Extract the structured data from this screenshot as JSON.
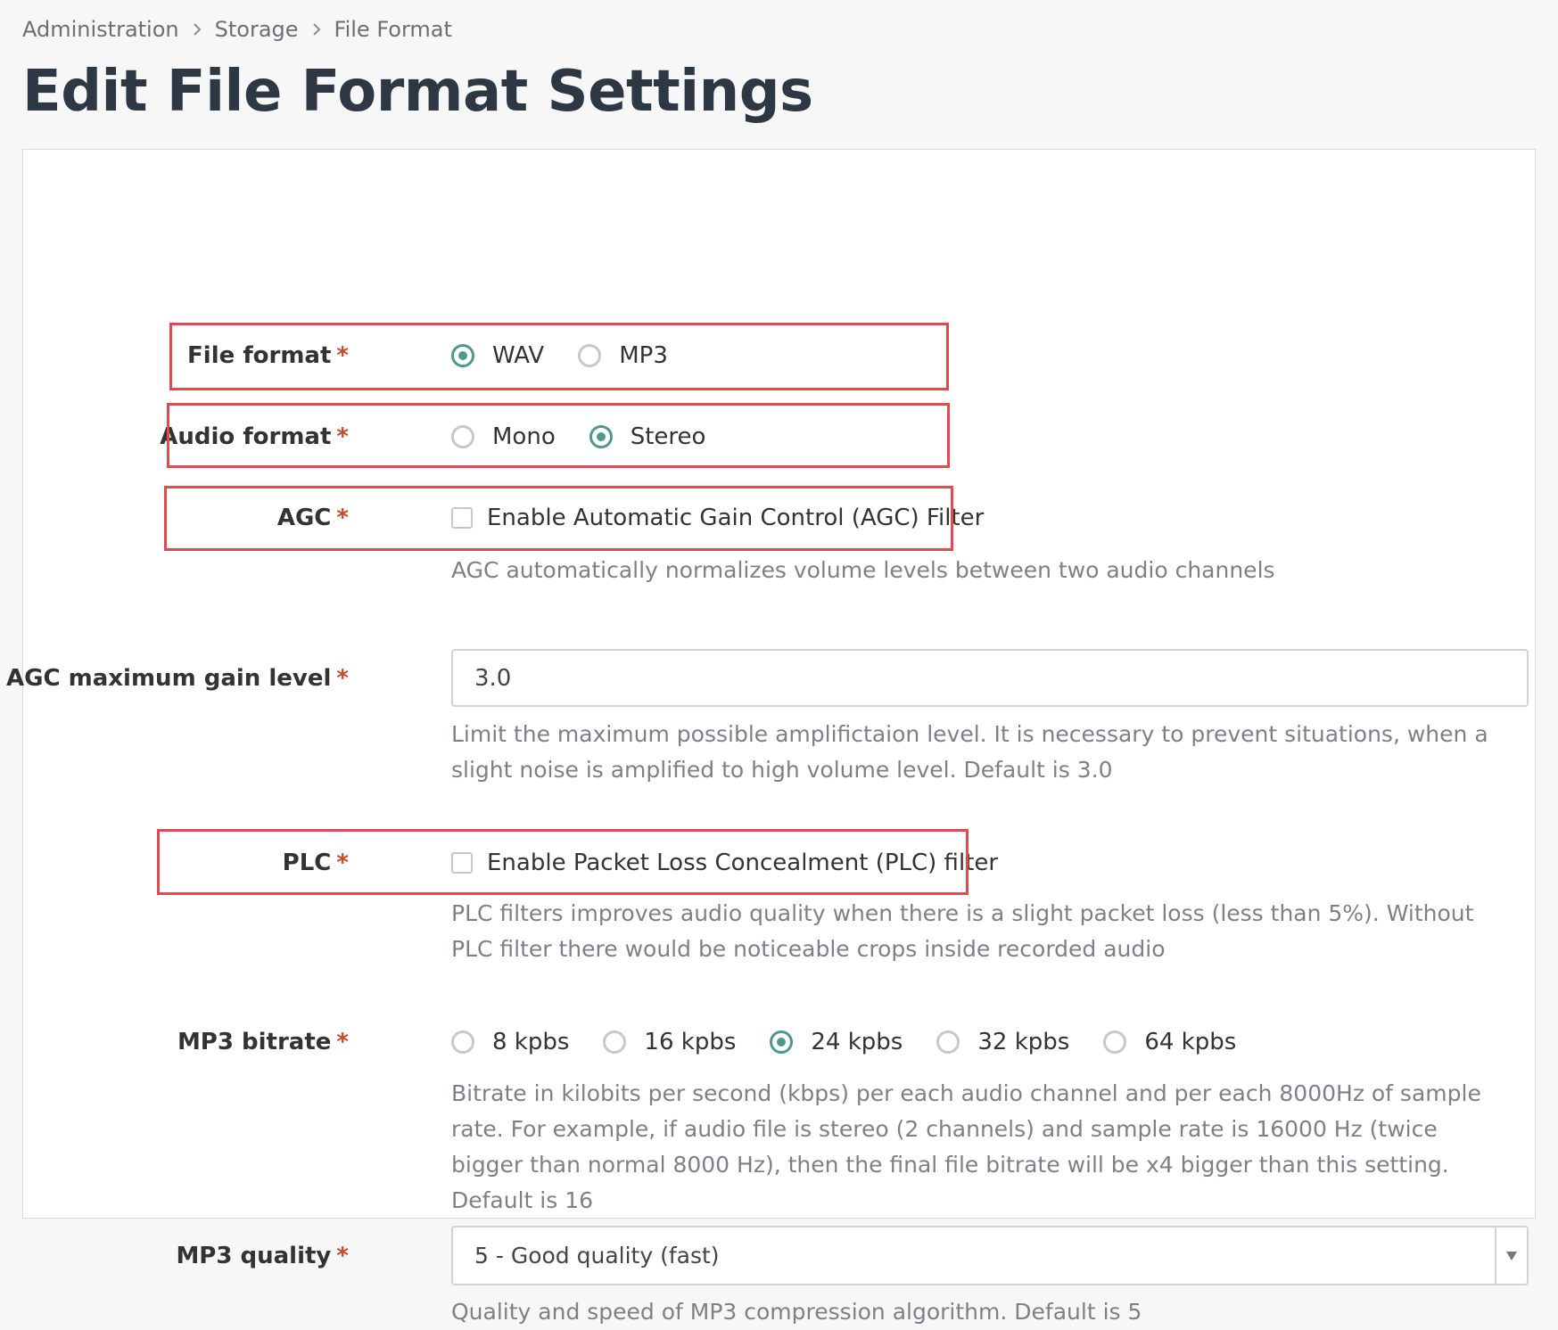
{
  "breadcrumb": [
    "Administration",
    "Storage",
    "File Format"
  ],
  "title": "Edit File Format Settings",
  "accent_color": "#4f9a86",
  "highlight_color": "#e34a4f",
  "required_marker": "*",
  "fields": {
    "file_format": {
      "label": "File format",
      "options": [
        "WAV",
        "MP3"
      ],
      "selected": "WAV"
    },
    "audio_format": {
      "label": "Audio format",
      "options": [
        "Mono",
        "Stereo"
      ],
      "selected": "Stereo"
    },
    "agc": {
      "label": "AGC",
      "checkbox_label": "Enable Automatic Gain Control (AGC) Filter",
      "checked": false,
      "help": "AGC automatically normalizes volume levels between two audio channels"
    },
    "agc_max_gain": {
      "label": "AGC maximum gain level",
      "value": "3.0",
      "help": "Limit the maximum possible amplifictaion level. It is necessary to prevent situations, when a slight noise is amplified to high volume level. Default is 3.0"
    },
    "plc": {
      "label": "PLC",
      "checkbox_label": "Enable Packet Loss Concealment (PLC) filter",
      "checked": false,
      "help": "PLC filters improves audio quality when there is a slight packet loss (less than 5%). Without PLC filter there would be noticeable crops inside recorded audio"
    },
    "mp3_bitrate": {
      "label": "MP3 bitrate",
      "options": [
        "8 kpbs",
        "16 kpbs",
        "24 kpbs",
        "32 kpbs",
        "64 kpbs"
      ],
      "selected": "24 kpbs",
      "help": "Bitrate in kilobits per second (kbps) per each audio channel and per each 8000Hz of sample rate. For example, if audio file is stereo (2 channels) and sample rate is 16000 Hz (twice bigger than normal 8000 Hz), then the final file bitrate will be x4 bigger than this setting. Default is 16"
    },
    "mp3_quality": {
      "label": "MP3 quality",
      "value": "5 - Good quality (fast)",
      "help": "Quality and speed of MP3 compression algorithm. Default is 5"
    }
  }
}
